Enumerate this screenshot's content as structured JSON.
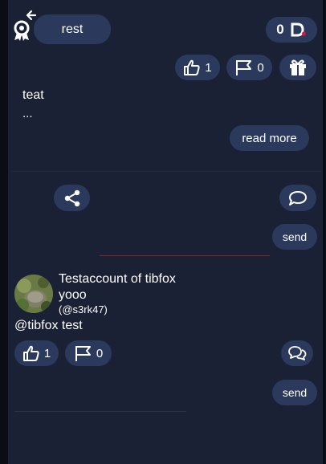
{
  "header": {
    "back_icon": "award-back-icon",
    "tab_label": "rest",
    "coin_count": "0"
  },
  "post": {
    "likes": "1",
    "flags": "0",
    "title": "teat",
    "excerpt": "...",
    "read_more_label": "read more",
    "send_label": "send"
  },
  "comment": {
    "author_name": "Testaccount of tibfox",
    "author_display": "yooo",
    "author_handle": "(@s3rk47)",
    "text": "@tibfox test",
    "likes": "1",
    "flags": "0",
    "send_label": "send"
  },
  "colors": {
    "background": "#1b2135",
    "pill": "#2b3a5c",
    "accent_red": "#e0143c",
    "divider_red": "#8b2330"
  }
}
